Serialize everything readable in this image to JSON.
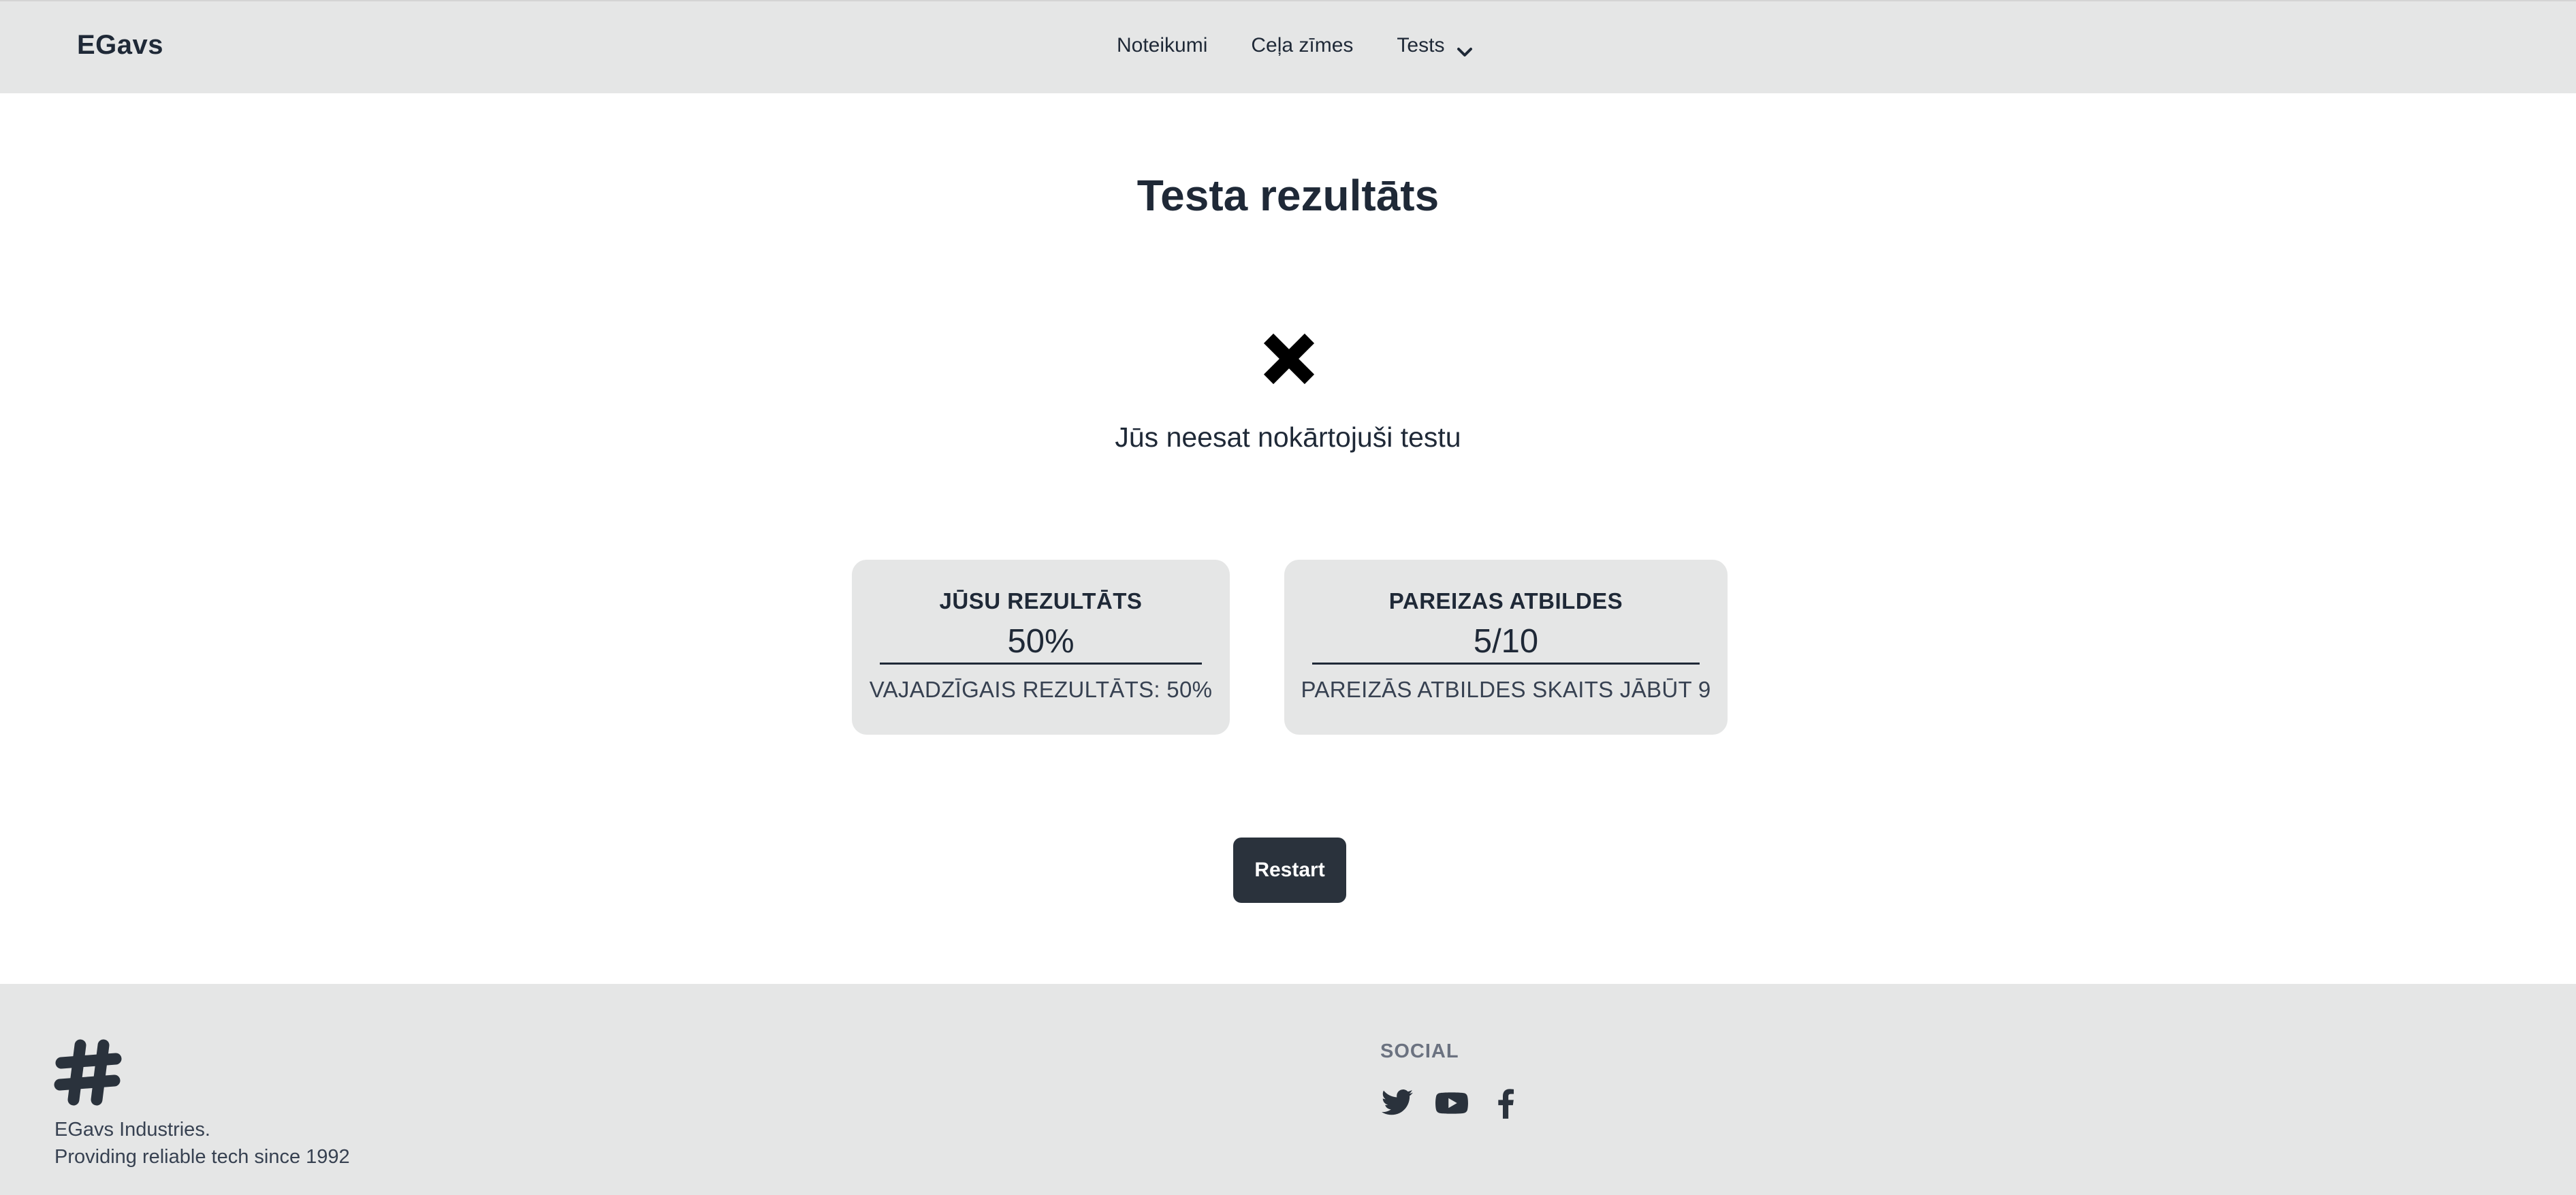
{
  "navbar": {
    "brand": "EGavs",
    "links": [
      {
        "label": "Noteikumi"
      },
      {
        "label": "Ceļa zīmes"
      }
    ],
    "dropdown": {
      "label": "Tests",
      "icon": "chevron-down-icon"
    }
  },
  "main": {
    "title": "Testa rezultāts",
    "status_icon": "close-icon",
    "status_text": "Jūs neesat nokārtojuši testu",
    "result_card": {
      "title": "JŪSU REZULTĀTS",
      "value": "50%",
      "description": "VAJADZĪGAIS REZULTĀTS: 50%"
    },
    "answers_card": {
      "title": "PAREIZAS ATBILDES",
      "value": "5/10",
      "description": "PAREIZĀS ATBILDES SKAITS JĀBŪT 9"
    },
    "restart_label": "Restart"
  },
  "footer": {
    "logo_icon": "hash-logo-icon",
    "company": "EGavs Industries.",
    "tagline": "Providing reliable tech since 1992",
    "social_title": "SOCIAL",
    "social_icons": [
      "twitter-icon",
      "youtube-icon",
      "facebook-icon"
    ]
  },
  "colors": {
    "navbar_bg": "#e5e6e6",
    "text": "#1f2937",
    "button_bg": "#2a323c",
    "card_bg": "#e5e6e6"
  }
}
